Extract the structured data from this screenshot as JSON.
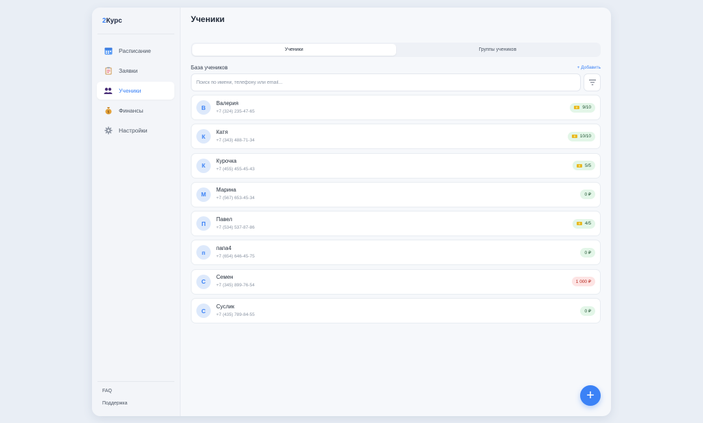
{
  "app": {
    "logo_prefix": "2",
    "logo_rest": "Курс"
  },
  "sidebar": {
    "items": [
      {
        "label": "Расписание",
        "icon": "calendar-icon",
        "active": false
      },
      {
        "label": "Заявки",
        "icon": "clipboard-icon",
        "active": false
      },
      {
        "label": "Ученики",
        "icon": "users-icon",
        "active": true
      },
      {
        "label": "Финансы",
        "icon": "money-bag-icon",
        "active": false
      },
      {
        "label": "Настройки",
        "icon": "gear-icon",
        "active": false
      }
    ],
    "footer": {
      "faq": "FAQ",
      "support": "Поддержка"
    }
  },
  "header": {
    "title": "Ученики"
  },
  "tabs": [
    {
      "label": "Ученики",
      "active": true
    },
    {
      "label": "Группы учеников",
      "active": false
    }
  ],
  "section": {
    "title": "База учеников",
    "add_label": "+ Добавить"
  },
  "search": {
    "placeholder": "Поиск по имени, телефону или email...",
    "value": ""
  },
  "students": [
    {
      "initial": "В",
      "name": "Валерия",
      "phone": "+7 (324) 235-47-65",
      "badge": "9/10",
      "ticket": true,
      "status": "green"
    },
    {
      "initial": "К",
      "name": "Катя",
      "phone": "+7 (343) 488-71-34",
      "badge": "10/10",
      "ticket": true,
      "status": "green"
    },
    {
      "initial": "К",
      "name": "Курочка",
      "phone": "+7 (455) 455-45-43",
      "badge": "5/5",
      "ticket": true,
      "status": "green"
    },
    {
      "initial": "М",
      "name": "Марина",
      "phone": "+7 (567) 653-45-34",
      "badge": "0 ₽",
      "ticket": false,
      "status": "green"
    },
    {
      "initial": "П",
      "name": "Павел",
      "phone": "+7 (534) 537-87-86",
      "badge": "4/5",
      "ticket": true,
      "status": "green"
    },
    {
      "initial": "п",
      "name": "папа4",
      "phone": "+7 (654) 646-45-75",
      "badge": "0 ₽",
      "ticket": false,
      "status": "green"
    },
    {
      "initial": "С",
      "name": "Семен",
      "phone": "+7 (345) 899-76-54",
      "badge": "1 000 ₽",
      "ticket": false,
      "status": "red"
    },
    {
      "initial": "С",
      "name": "Суслик",
      "phone": "+7 (435) 789-84-55",
      "badge": "0 ₽",
      "ticket": false,
      "status": "green"
    }
  ],
  "colors": {
    "accent": "#3b82f6",
    "badge_green": "#e3f6e8",
    "badge_red": "#fde4e4",
    "ticket": "#e8b923"
  },
  "fab": {
    "label": "+"
  }
}
